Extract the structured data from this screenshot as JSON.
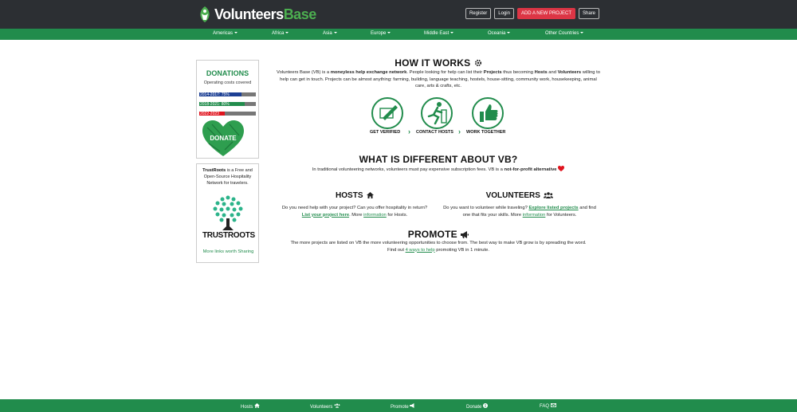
{
  "brand": {
    "name_part1": "Volunteers",
    "name_part2": "Base"
  },
  "top_actions": {
    "register": "Register",
    "login": "Login",
    "add_project": "ADD A NEW PROJECT",
    "share": "Share"
  },
  "nav": [
    "Americas",
    "Africa",
    "Asia",
    "Europe",
    "Middle East",
    "Oceania",
    "Other Countries"
  ],
  "donations": {
    "title": "DONATIONS",
    "subtitle": "Operating costs covered",
    "bars": [
      {
        "label": "2014-2017: 75%",
        "fraction": 0.75,
        "color": "#1c3f94"
      },
      {
        "label": "2018-2021: 80%",
        "fraction": 0.8,
        "color": "#218c4c"
      },
      {
        "label": "2022-2023",
        "fraction": 0.45,
        "color": "#e0141e"
      }
    ],
    "heart_label": "DONATE"
  },
  "trustroots": {
    "name_bold": "TrustRoots",
    "desc": " is a Free and Open-Source Hospitality Network for travelers.",
    "logo_text": "TRUSTROOTS",
    "more_links": "More links worth Sharing"
  },
  "how": {
    "title": "HOW IT WORKS",
    "p1": "Volunteers Base (VB) is a ",
    "p1_bold": "moneyless help exchange network",
    "p2": ". People looking for help can list their ",
    "p2_bold": "Projects",
    "p3": " thus becoming ",
    "p3_bold": "Hosts",
    "p4": " and ",
    "p4_bold": "Volunteers",
    "p5": " willing to help can get in touch. Projects can be almost anything: farming, building, language teaching, hostels, house-sitting, community work, housekeeping, animal care, arts & crafts, etc.",
    "steps": [
      "GET VERIFIED",
      "CONTACT HOSTS",
      "WORK TOGETHER"
    ]
  },
  "different": {
    "title": "WHAT IS DIFFERENT ABOUT VB?",
    "text": "In traditional volunteering networks, volunteers must pay expensive subscription fees. VB is a ",
    "bold": "not-for-profit alternative"
  },
  "hosts": {
    "title": "HOSTS",
    "t1": "Do you need help with your project? Can you offer hospitality in return? ",
    "link1": "List your project here",
    "t2": ". More ",
    "link2": "information",
    "t3": " for Hosts."
  },
  "volunteers": {
    "title": "VOLUNTEERS",
    "t1": "Do you want to volunteer while traveling? ",
    "link1": "Explore listed projects",
    "t2": " and find one that fits your skills. More ",
    "link2": "information",
    "t3": " for Volunteers."
  },
  "promote": {
    "title": "PROMOTE",
    "t1": "The more projects are listed on VB the more volunteering opportunities to choose from. The best way to make VB grow is by spreading the word.",
    "t2": "Find out ",
    "link": "4 ways to help",
    "t3": " promoting VB in 1 minute."
  },
  "footer": [
    "Hosts",
    "Volunteers",
    "Promote",
    "Donate",
    "FAQ"
  ],
  "colors": {
    "green": "#218c4c",
    "dark": "#2c2f33",
    "red": "#dc3545"
  }
}
